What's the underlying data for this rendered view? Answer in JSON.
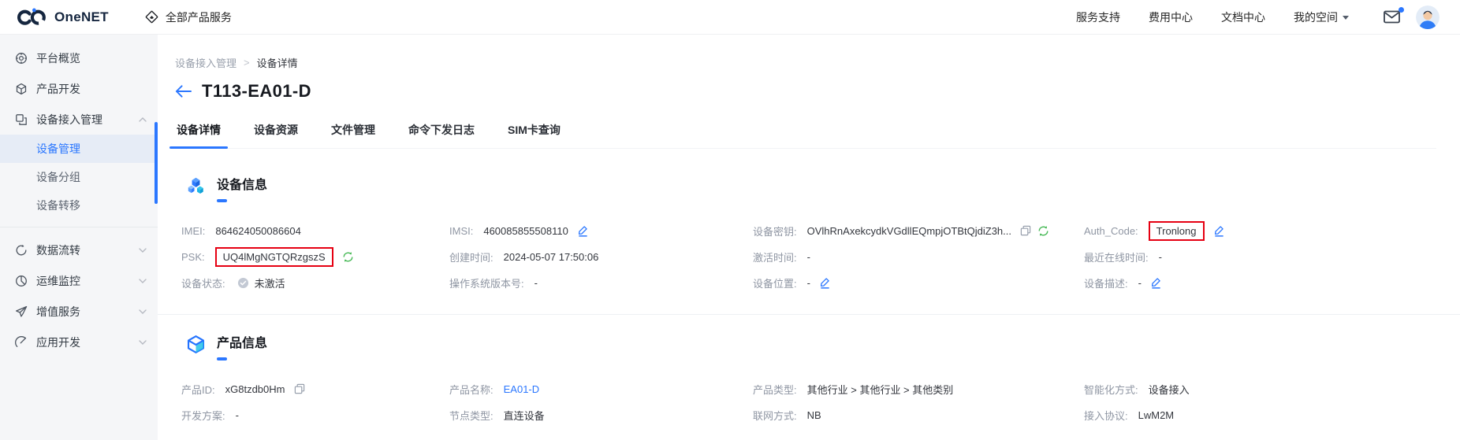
{
  "colors": {
    "accent": "#2b77ff",
    "highlight_red": "#e60012",
    "refresh_green": "#45b854"
  },
  "header": {
    "logo": "OneNET",
    "all_products": "全部产品服务",
    "nav": [
      {
        "label": "服务支持"
      },
      {
        "label": "费用中心"
      },
      {
        "label": "文档中心"
      },
      {
        "label": "我的空间"
      }
    ]
  },
  "sidebar": {
    "items": [
      {
        "label": "平台概览"
      },
      {
        "label": "产品开发"
      },
      {
        "label": "设备接入管理"
      },
      {
        "label": "设备管理"
      },
      {
        "label": "设备分组"
      },
      {
        "label": "设备转移"
      },
      {
        "label": "数据流转"
      },
      {
        "label": "运维监控"
      },
      {
        "label": "增值服务"
      },
      {
        "label": "应用开发"
      }
    ]
  },
  "breadcrumb": {
    "level1": "设备接入管理",
    "separator": ">",
    "level2": "设备详情"
  },
  "page": {
    "title": "T113-EA01-D"
  },
  "tabs": {
    "items": [
      {
        "label": "设备详情"
      },
      {
        "label": "设备资源"
      },
      {
        "label": "文件管理"
      },
      {
        "label": "命令下发日志"
      },
      {
        "label": "SIM卡查询"
      }
    ]
  },
  "device_info": {
    "title": "设备信息",
    "fields": {
      "imei": {
        "label": "IMEI:",
        "value": "864624050086604"
      },
      "imsi": {
        "label": "IMSI:",
        "value": "460085855508110"
      },
      "secret": {
        "label": "设备密钥:",
        "value": "OVlhRnAxekcydkVGdllEQmpjOTBtQjdiZ3h..."
      },
      "auth_code": {
        "label": "Auth_Code:",
        "value": "Tronlong"
      },
      "psk": {
        "label": "PSK:",
        "value": "UQ4lMgNGTQRzgszS"
      },
      "created": {
        "label": "创建时间:",
        "value": "2024-05-07 17:50:06"
      },
      "activated": {
        "label": "激活时间:",
        "value": "-"
      },
      "last_online": {
        "label": "最近在线时间:",
        "value": "-"
      },
      "status": {
        "label": "设备状态:",
        "value": "未激活"
      },
      "os_version": {
        "label": "操作系统版本号:",
        "value": "-"
      },
      "location": {
        "label": "设备位置:",
        "value": "-"
      },
      "description": {
        "label": "设备描述:",
        "value": "-"
      }
    }
  },
  "product_info": {
    "title": "产品信息",
    "fields": {
      "product_id": {
        "label": "产品ID:",
        "value": "xG8tzdb0Hm"
      },
      "product_name": {
        "label": "产品名称:",
        "value": "EA01-D"
      },
      "product_type": {
        "label": "产品类型:",
        "value": "其他行业 > 其他行业 > 其他类别"
      },
      "smart_mode": {
        "label": "智能化方式:",
        "value": "设备接入"
      },
      "dev_plan": {
        "label": "开发方案:",
        "value": "-"
      },
      "node_type": {
        "label": "节点类型:",
        "value": "直连设备"
      },
      "network": {
        "label": "联网方式:",
        "value": "NB"
      },
      "protocol": {
        "label": "接入协议:",
        "value": "LwM2M"
      }
    }
  }
}
